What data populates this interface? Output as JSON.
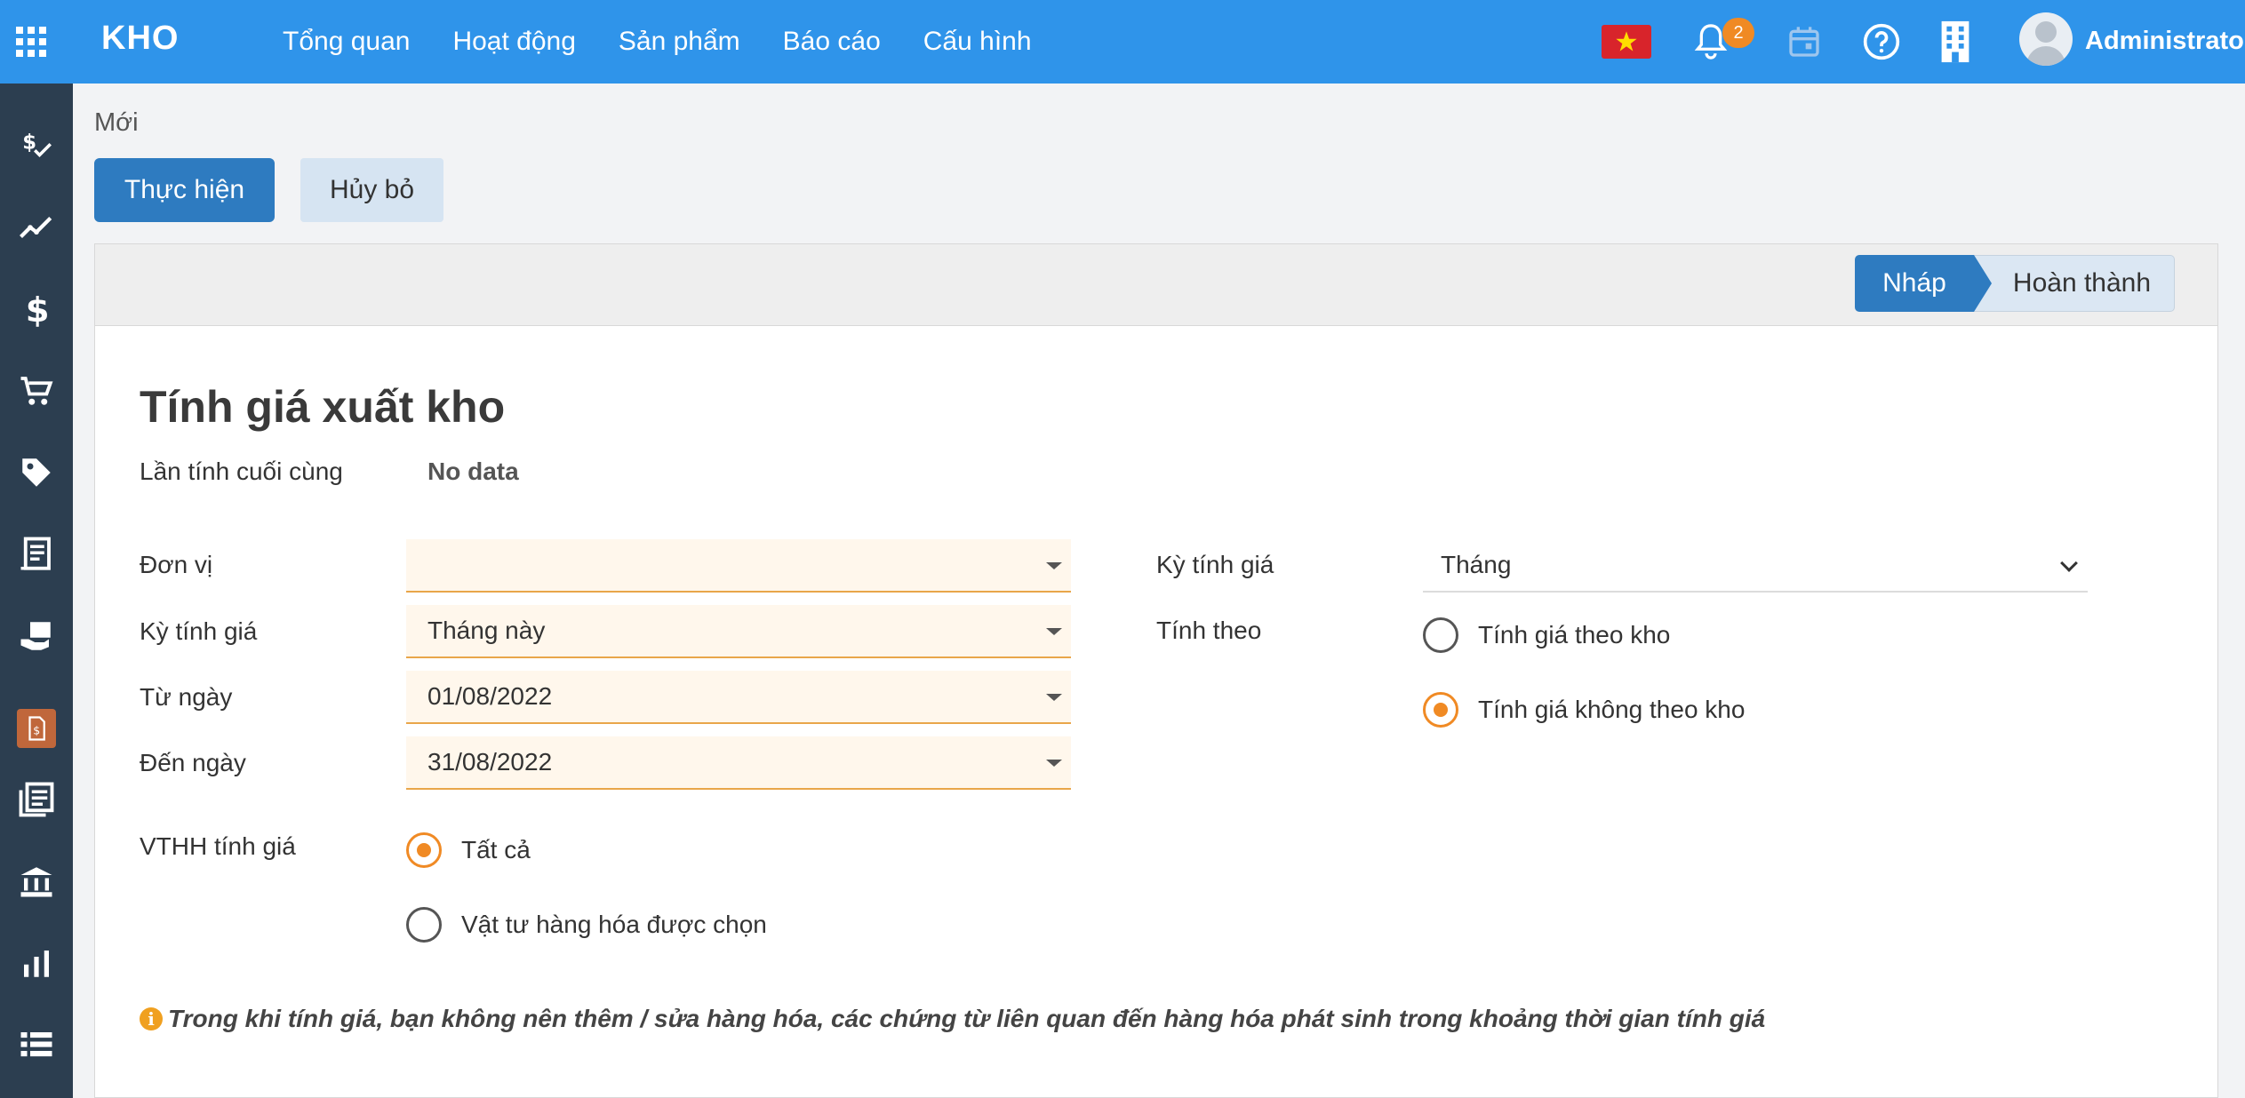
{
  "app": {
    "brand": "KHO",
    "username": "Administrator",
    "notification_count": "2"
  },
  "topnav": [
    "Tổng quan",
    "Hoạt động",
    "Sản phẩm",
    "Báo cáo",
    "Cấu hình"
  ],
  "breadcrumb": "Mới",
  "actions": {
    "execute": "Thực hiện",
    "cancel": "Hủy bỏ"
  },
  "status": {
    "draft": "Nháp",
    "done": "Hoàn thành"
  },
  "form": {
    "title": "Tính giá xuất kho",
    "last_calc_label": "Lần tính cuối cùng",
    "last_calc_value": "No data",
    "unit_label": "Đơn vị",
    "unit_value": "",
    "period_label": "Kỳ tính giá",
    "period_value": "Tháng này",
    "from_label": "Từ ngày",
    "from_value": "01/08/2022",
    "to_label": "Đến ngày",
    "to_value": "31/08/2022",
    "goods_label": "VTHH tính giá",
    "goods_all": "Tất cả",
    "goods_selected": "Vật tư hàng hóa được chọn",
    "period_type_label": "Kỳ tính giá",
    "period_type_value": "Tháng",
    "calc_by_label": "Tính theo",
    "calc_by_warehouse": "Tính giá theo kho",
    "calc_by_no_warehouse": "Tính giá không theo kho",
    "note": "Trong khi tính giá, bạn không nên thêm / sửa hàng hóa, các chứng từ liên quan đến hàng hóa phát sinh trong khoảng thời gian tính giá"
  },
  "colors": {
    "topbar": "#2f94ea",
    "sidebar": "#2c3e50",
    "primary": "#2e7bc0",
    "accent": "#f08a24",
    "field_bg": "#fff7ec"
  },
  "sidebar_icons": [
    "money-check-icon",
    "trend-chart-icon",
    "dollar-icon",
    "cart-icon",
    "tag-icon",
    "receipt-icon",
    "hand-money-icon",
    "invoice-icon",
    "book-list-icon",
    "bank-icon",
    "bar-chart-icon",
    "list-icon"
  ]
}
